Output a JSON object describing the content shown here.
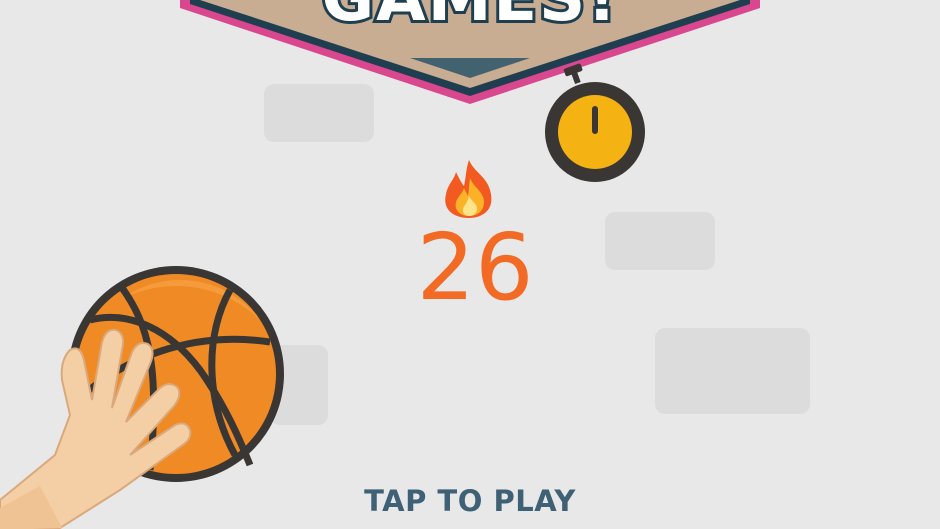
{
  "game": {
    "title_fragment": "GAMES!",
    "score": "26",
    "prompt": "TAP TO PLAY"
  },
  "icons": {
    "streak": "fire-icon",
    "timer": "stopwatch-icon",
    "ball": "basketball-icon",
    "hand": "hand-icon"
  },
  "colors": {
    "background": "#e8e8e8",
    "score": "#f26a24",
    "prompt": "#3f6175",
    "banner_fill": "#c9ad92",
    "banner_outline": "#1f3f50",
    "banner_trim": "#d9478f",
    "stopwatch_face": "#f5b213",
    "ball": "#f08a24"
  }
}
